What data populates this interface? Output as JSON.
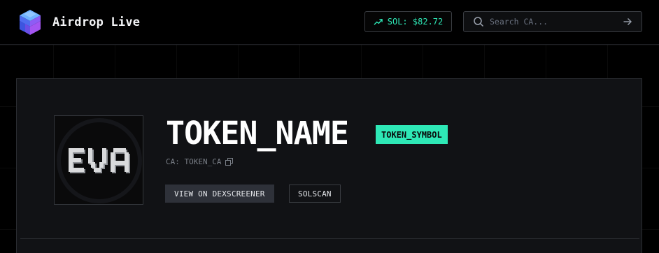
{
  "header": {
    "brand_title": "Airdrop Live",
    "sol_price": "SOL: $82.72",
    "search_placeholder": "Search CA..."
  },
  "token": {
    "name": "TOKEN_NAME",
    "symbol": "TOKEN_SYMBOL",
    "ca_label": "CA: TOKEN_CA",
    "image_text": "EVA"
  },
  "actions": {
    "dexscreener_label": "VIEW ON DEXSCREENER",
    "solscan_label": "SOLSCAN"
  },
  "colors": {
    "accent": "#2ee8b6",
    "background": "#000000",
    "card": "#111215"
  },
  "icons": {
    "brand": "stacked-cubes-logo",
    "sol": "trending-up-icon",
    "search": "search-icon",
    "submit": "arrow-right-icon",
    "copy": "copy-icon"
  }
}
